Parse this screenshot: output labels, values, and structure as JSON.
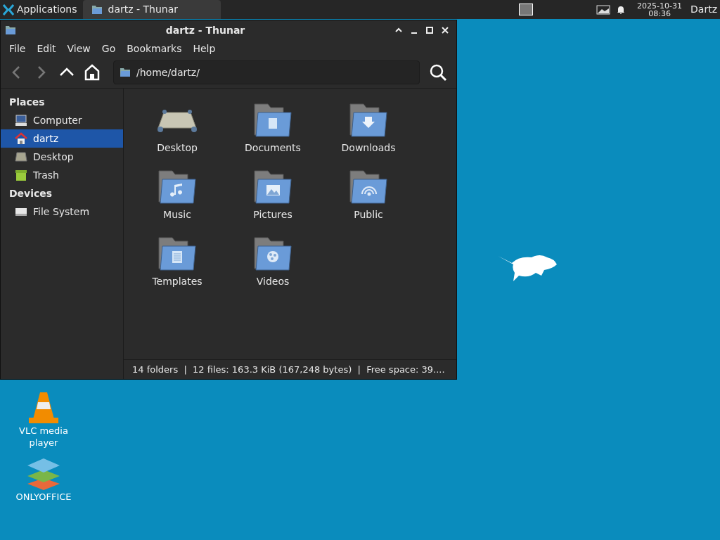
{
  "taskbar": {
    "menu_label": "Applications",
    "tasks": [
      {
        "label": "dartz - Thunar",
        "selected": true
      }
    ],
    "date": "2025-10-31",
    "time": "08:36",
    "user": "Dartz"
  },
  "window": {
    "title": "dartz - Thunar",
    "menu": [
      "File",
      "Edit",
      "View",
      "Go",
      "Bookmarks",
      "Help"
    ],
    "location": "/home/dartz/",
    "sidebar": [
      {
        "heading": "Places",
        "items": [
          {
            "label": "Computer",
            "kind": "computer",
            "selected": false
          },
          {
            "label": "dartz",
            "kind": "home",
            "selected": true
          },
          {
            "label": "Desktop",
            "kind": "desktop",
            "selected": false
          },
          {
            "label": "Trash",
            "kind": "trash",
            "selected": false
          }
        ]
      },
      {
        "heading": "Devices",
        "items": [
          {
            "label": "File System",
            "kind": "drive",
            "selected": false
          }
        ]
      }
    ],
    "items": [
      {
        "label": "Desktop",
        "kind": "desktop"
      },
      {
        "label": "Documents",
        "kind": "document"
      },
      {
        "label": "Downloads",
        "kind": "download"
      },
      {
        "label": "Music",
        "kind": "music"
      },
      {
        "label": "Pictures",
        "kind": "picture"
      },
      {
        "label": "Public",
        "kind": "public"
      },
      {
        "label": "Templates",
        "kind": "template"
      },
      {
        "label": "Videos",
        "kind": "video"
      }
    ],
    "status": "14 folders  |  12 files: 163.3 KiB (167,248 bytes)  |  Free space: 39...."
  },
  "desktop_icons": [
    {
      "label": "VLC media player",
      "kind": "vlc"
    },
    {
      "label": "ONLYOFFICE",
      "kind": "office"
    }
  ]
}
